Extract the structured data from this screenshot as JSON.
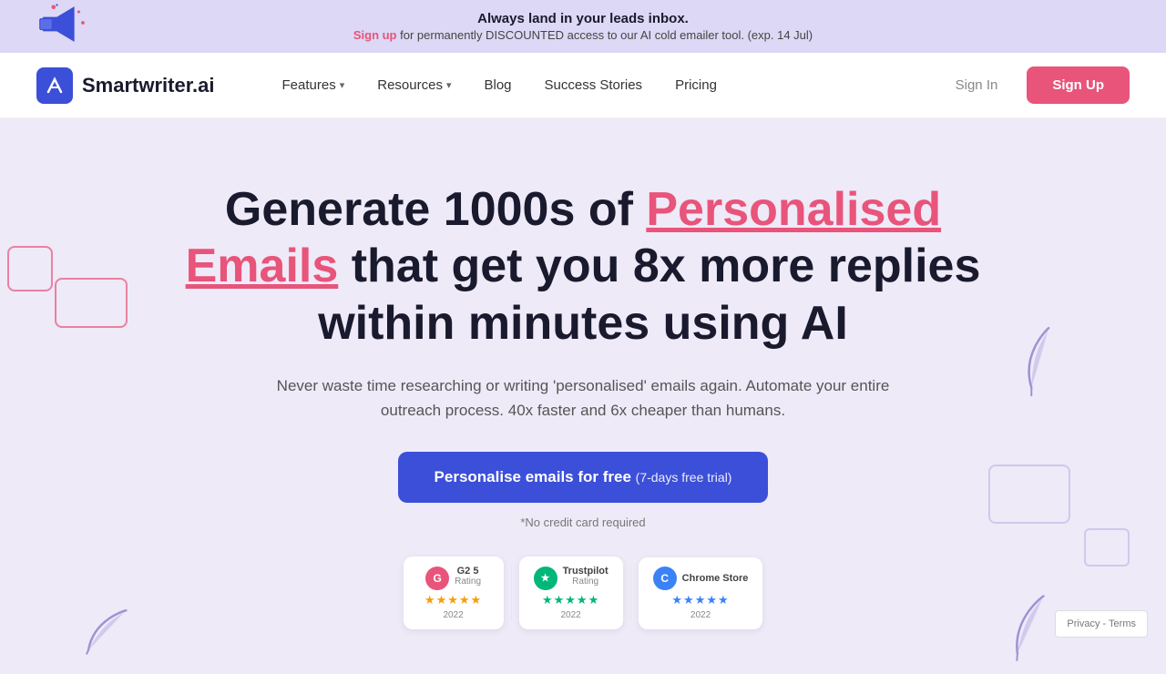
{
  "banner": {
    "main_text": "Always land in your leads inbox.",
    "sub_text_prefix": "",
    "sign_up_text": "Sign up",
    "sub_text_suffix": " for permanently DISCOUNTED access to our AI cold emailer tool. (exp. 14 Jul)"
  },
  "nav": {
    "logo_text": "Smartwriter.ai",
    "features_label": "Features",
    "resources_label": "Resources",
    "blog_label": "Blog",
    "success_stories_label": "Success Stories",
    "pricing_label": "Pricing",
    "sign_in_label": "Sign In",
    "sign_up_label": "Sign Up"
  },
  "hero": {
    "title_start": "Generate 1000s of ",
    "title_highlight": "Personalised Emails",
    "title_end": " that get you 8x more replies within minutes using AI",
    "subtitle": "Never waste time researching or writing 'personalised' emails again. Automate your entire outreach process. 40x faster and 6x cheaper than humans.",
    "cta_label": "Personalise emails for free",
    "cta_trial": "(7-days free trial)",
    "cta_note": "*No credit card required"
  },
  "badges": [
    {
      "icon_label": "G",
      "icon_type": "g2",
      "name": "G2 5",
      "sub": "Rating",
      "stars": "★★★★★",
      "star_type": "orange",
      "year": "2022"
    },
    {
      "icon_label": "✓",
      "icon_type": "tp",
      "name": "Trustpilot",
      "sub": "Rating",
      "stars": "★★★★★",
      "star_type": "green",
      "year": "2022"
    },
    {
      "icon_label": "C",
      "icon_type": "cs",
      "name": "Chrome Store",
      "sub": "",
      "stars": "★★★★★",
      "star_type": "blue",
      "year": "2022"
    }
  ]
}
